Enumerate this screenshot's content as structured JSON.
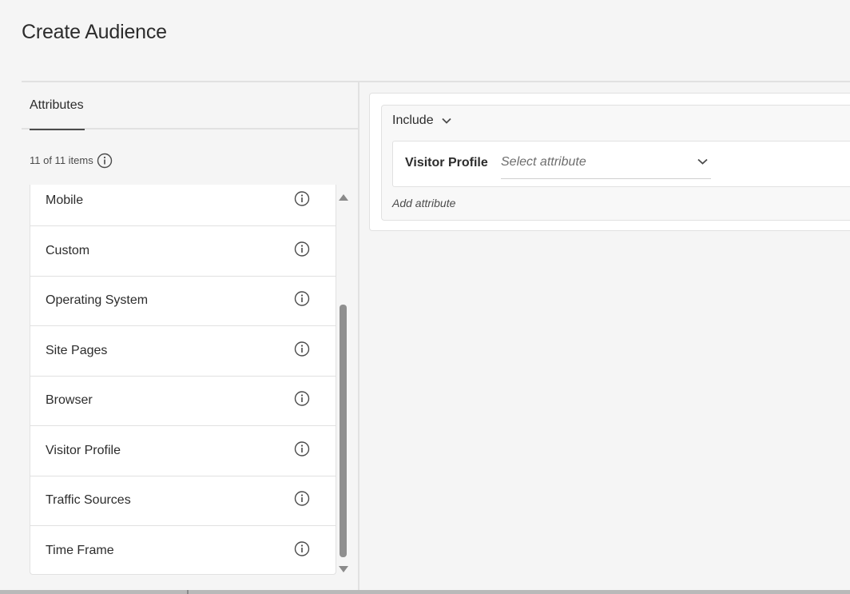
{
  "page": {
    "title": "Create Audience"
  },
  "left_panel": {
    "tab_label": "Attributes",
    "item_count": "11 of 11 items",
    "items": [
      {
        "label": "Mobile"
      },
      {
        "label": "Custom"
      },
      {
        "label": "Operating System"
      },
      {
        "label": "Site Pages"
      },
      {
        "label": "Browser"
      },
      {
        "label": "Visitor Profile"
      },
      {
        "label": "Traffic Sources"
      },
      {
        "label": "Time Frame"
      }
    ]
  },
  "rule": {
    "include_label": "Include",
    "attribute_name": "Visitor Profile",
    "select_placeholder": "Select attribute",
    "add_attribute_label": "Add attribute"
  },
  "icons": {
    "info": "info-icon",
    "chevron": "chevron-down-icon",
    "scroll_up": "scroll-up-arrow-icon",
    "scroll_down": "scroll-down-arrow-icon"
  },
  "colors": {
    "background": "#f5f5f5",
    "text": "#2c2c2c",
    "border": "#e1e1e1",
    "scroll_thumb": "#8f8f8f"
  }
}
